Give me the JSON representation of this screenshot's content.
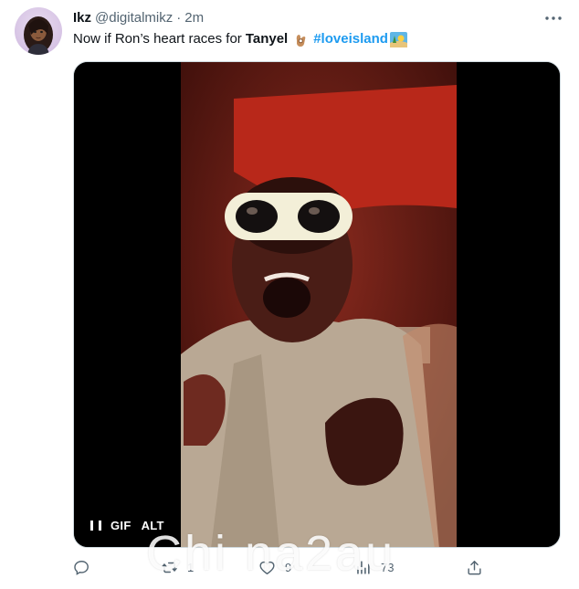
{
  "tweet": {
    "display_name": "Ikz",
    "handle": "@digitalmikz",
    "separator": "·",
    "time": "2m",
    "text_part1": "Now if Ron’s heart races for",
    "text_bold": "Tanyel",
    "hashtag": "#loveisland",
    "emoji_1": "ok-hand-emoji",
    "emoji_2": "island-emoji"
  },
  "media": {
    "label_gif": "GIF",
    "label_alt": "ALT"
  },
  "actions": {
    "reply_count": "",
    "retweet_count": "1",
    "like_count": "9",
    "views_count": "73"
  },
  "watermark": {
    "text": "Chi na2au"
  },
  "colors": {
    "accent": "#1d9bf0",
    "secondary_text": "#536471",
    "primary_text": "#0f1419"
  }
}
